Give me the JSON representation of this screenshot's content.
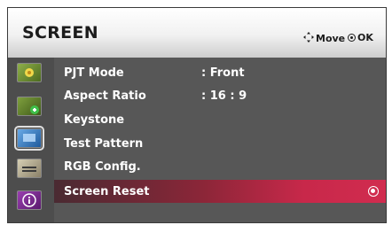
{
  "header": {
    "title": "SCREEN",
    "move_label": "Move",
    "ok_label": "OK"
  },
  "sidebar": {
    "icons": [
      {
        "name": "picture-icon",
        "color": "#6a8a2a"
      },
      {
        "name": "audio-icon",
        "color": "#5b7a26"
      },
      {
        "name": "screen-icon",
        "color": "#2f6fb3"
      },
      {
        "name": "option-icon",
        "color": "#a59a7a"
      },
      {
        "name": "info-icon",
        "color": "#7b2d8a"
      }
    ],
    "active_index": 2
  },
  "menu": {
    "items": [
      {
        "label": "PJT Mode",
        "value": ": Front"
      },
      {
        "label": "Aspect Ratio",
        "value": ": 16 : 9"
      },
      {
        "label": "Keystone",
        "value": ""
      },
      {
        "label": "Test Pattern",
        "value": ""
      },
      {
        "label": "RGB Config.",
        "value": ""
      },
      {
        "label": "Screen Reset",
        "value": ""
      }
    ],
    "selected_index": 5
  },
  "colors": {
    "selection": "#c8284a",
    "panel": "#575757"
  }
}
